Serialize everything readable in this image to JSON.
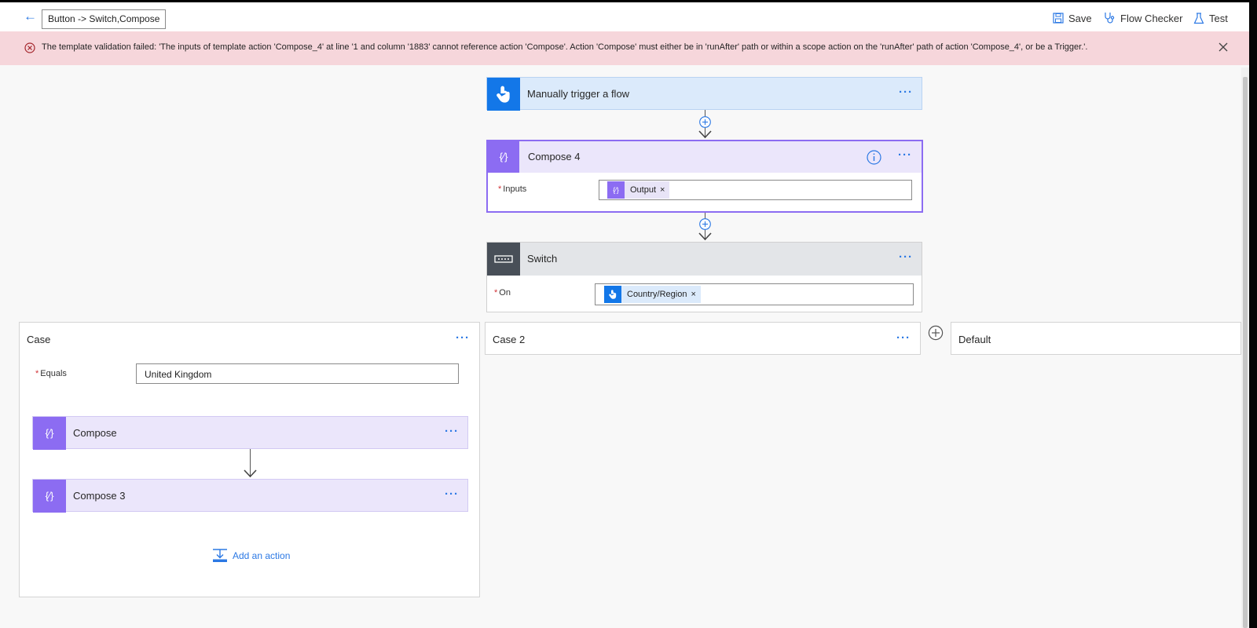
{
  "header": {
    "title": "Button -> Switch,Compose",
    "save_label": "Save",
    "flow_checker_label": "Flow Checker",
    "test_label": "Test"
  },
  "error": {
    "message": "The template validation failed: 'The inputs of template action 'Compose_4' at line '1 and column '1883' cannot reference action 'Compose'. Action 'Compose' must either be in 'runAfter' path or within a scope action on the 'runAfter' path of action 'Compose_4', or be a Trigger.'."
  },
  "trigger": {
    "title": "Manually trigger a flow"
  },
  "compose4": {
    "title": "Compose 4",
    "inputs_label": "Inputs",
    "token": "Output"
  },
  "switch": {
    "title": "Switch",
    "on_label": "On",
    "token": "Country/Region"
  },
  "case1": {
    "title": "Case",
    "equals_label": "Equals",
    "equals_value": "United Kingdom",
    "actions": [
      "Compose",
      "Compose 3"
    ],
    "add_action_label": "Add an action"
  },
  "case2": {
    "title": "Case 2"
  },
  "default": {
    "title": "Default"
  },
  "colors": {
    "accent": "#2b78e4",
    "compose": "#8c6cf2",
    "trigger": "#1377e8",
    "switch": "#484f58",
    "error_bg": "#f6d6db"
  }
}
